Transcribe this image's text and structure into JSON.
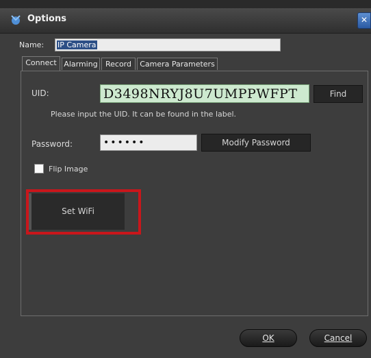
{
  "window": {
    "title": "Options",
    "close_glyph": "✕"
  },
  "name_field": {
    "label": "Name:",
    "value": "IP Camera"
  },
  "tabs": [
    {
      "label": "Connect",
      "active": true
    },
    {
      "label": "Alarming",
      "active": false
    },
    {
      "label": "Record",
      "active": false
    },
    {
      "label": "Camera Parameters",
      "active": false
    }
  ],
  "connect": {
    "uid_label": "UID:",
    "uid_value": "D3498NRYJ8U7UMPPWFPT",
    "find_button": "Find",
    "hint": "Please input the UID. It can be found in the label.",
    "password_label": "Password:",
    "password_value": "••••••",
    "modify_password_button": "Modify Password",
    "flip_image_label": "Flip Image",
    "flip_image_checked": false,
    "set_wifi_button": "Set WiFi"
  },
  "footer": {
    "ok_button": "OK",
    "cancel_button": "Cancel"
  },
  "colors": {
    "highlight": "#c9161b",
    "uid_background": "#cde9cf",
    "window_background": "#3d3d3d"
  }
}
